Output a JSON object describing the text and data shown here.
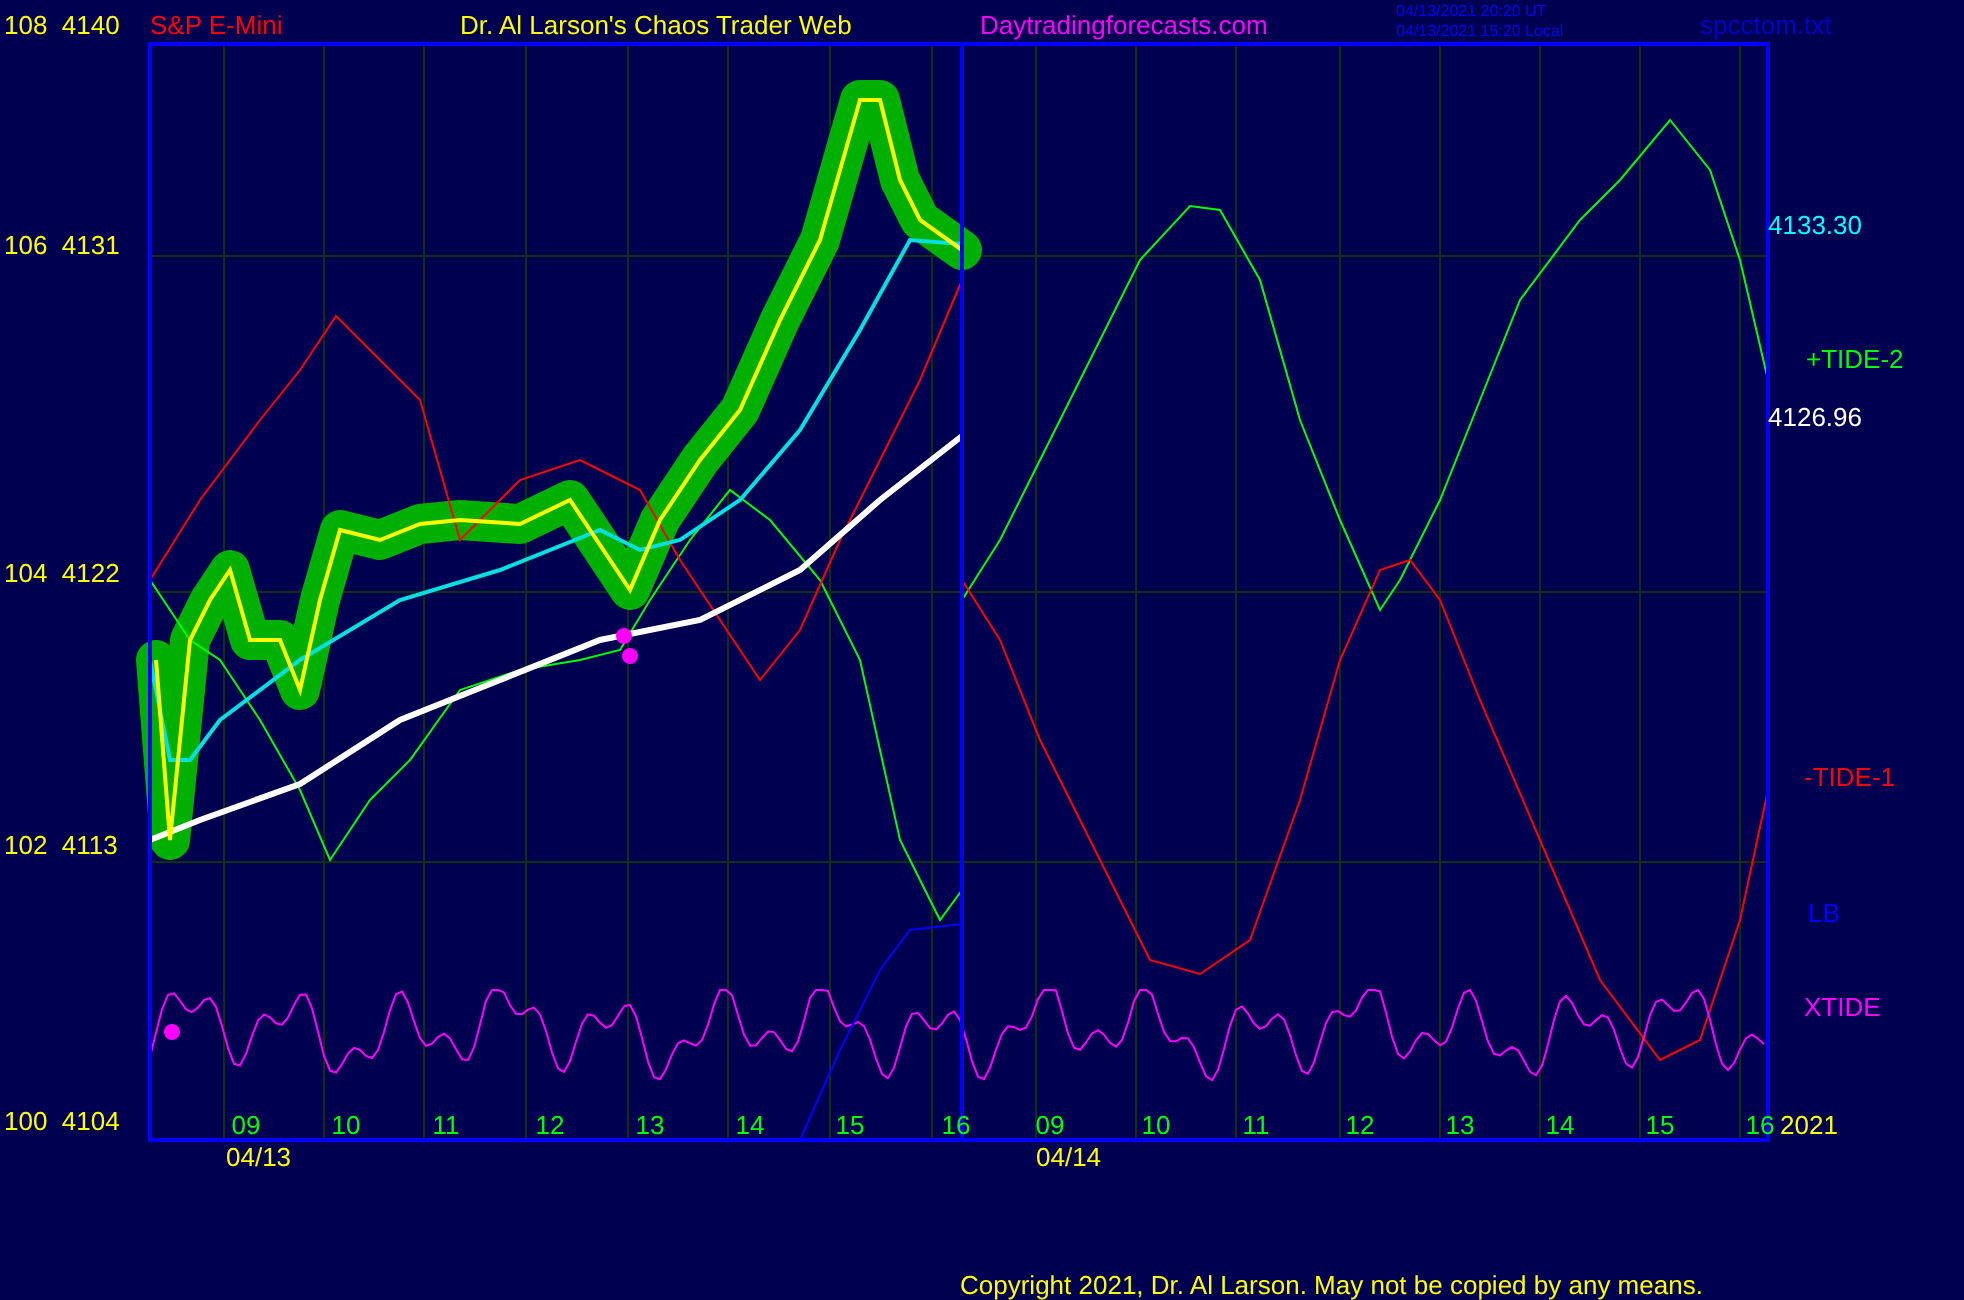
{
  "header": {
    "symbol": "S&P E-Mini",
    "title": "Dr. Al Larson's Chaos Trader Web",
    "site": "Daytradingforecasts.com",
    "times": [
      "04/13/2021 20:20 UT",
      "04/13/2021 15:20 Local"
    ],
    "file": "spcctom.txt"
  },
  "y_axis": [
    "108  4140",
    "106  4131",
    "104  4122",
    "102  4113",
    "100  4104"
  ],
  "x_axis": [
    "09",
    "10",
    "11",
    "12",
    "13",
    "14",
    "15",
    "16",
    "09",
    "10",
    "11",
    "12",
    "13",
    "14",
    "15",
    "16"
  ],
  "dates": [
    "04/13",
    "04/14"
  ],
  "right_labels": [
    {
      "text": "4133.30",
      "color": "#00ffff"
    },
    {
      "text": "+TIDE-2",
      "color": "#00ff00"
    },
    {
      "text": "4126.96",
      "color": "#ffffff"
    },
    {
      "text": "-TIDE-1",
      "color": "#ff0000"
    },
    {
      "text": "LB",
      "color": "#0000ff"
    },
    {
      "text": "XTIDE",
      "color": "#ff00ff"
    }
  ],
  "year": "2021",
  "copyright": "Copyright 2021, Dr. Al Larson. May not be copied by any means."
}
